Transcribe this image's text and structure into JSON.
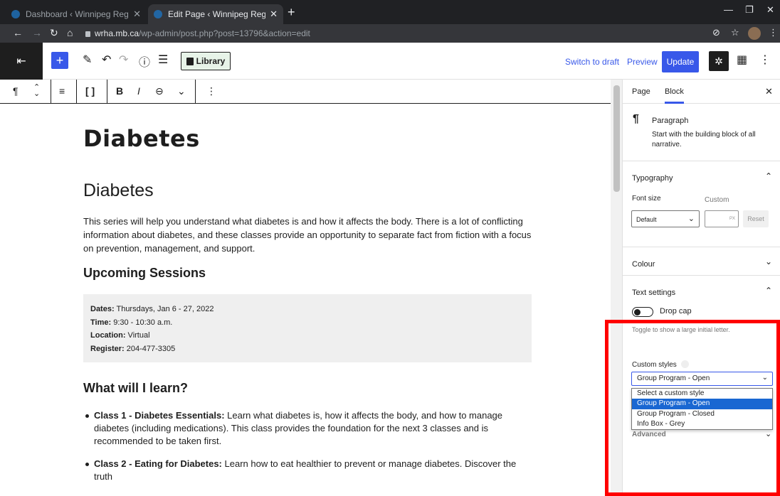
{
  "browser": {
    "tabs": [
      {
        "title": "Dashboard ‹ Winnipeg Regional He",
        "close": "✕"
      },
      {
        "title": "Edit Page ‹ Winnipeg Regional He",
        "close": "✕"
      }
    ],
    "new_tab": "+",
    "url_domain": "wrha.mb.ca",
    "url_path": "/wp-admin/post.php?post=13796&action=edit"
  },
  "editor_toolbar": {
    "library_label": "Library",
    "switch_to_draft": "Switch to draft",
    "preview": "Preview",
    "update": "Update"
  },
  "content": {
    "page_title": "Diabetes",
    "heading": "Diabetes",
    "intro": "This series will help you understand what diabetes is and how it affects the body. There is a lot of conflicting information about diabetes, and these classes provide an opportunity to separate fact from fiction with a focus on prevention, management, and support.",
    "upcoming_heading": "Upcoming Sessions",
    "info": [
      {
        "label": "Dates:",
        "value": " Thursdays, Jan 6 - 27, 2022"
      },
      {
        "label": "Time:",
        "value": " 9:30 - 10:30 a.m."
      },
      {
        "label": "Location:",
        "value": " Virtual"
      },
      {
        "label": "Register:",
        "value": " 204-477-3305"
      }
    ],
    "learn_heading": "What will I learn?",
    "classes": [
      {
        "label": "Class 1 - Diabetes Essentials:",
        "text": " Learn what diabetes is, how it affects the body, and how to manage diabetes (including medications). This class provides the foundation for the next 3 classes and is recommended to be taken first."
      },
      {
        "label": "Class 2 - Eating for Diabetes:",
        "text": " Learn how to eat healthier to prevent or manage diabetes. Discover the truth"
      }
    ]
  },
  "sidebar": {
    "tabs": [
      "Page",
      "Block"
    ],
    "active_tab": "Block",
    "block_name": "Paragraph",
    "block_desc": "Start with the building block of all narrative.",
    "typography": "Typography",
    "font_size_label": "Font size",
    "custom_label": "Custom",
    "font_size_value": "Default",
    "custom_unit": "PX",
    "reset": "Reset",
    "colour": "Colour",
    "text_settings": "Text settings",
    "drop_cap": "Drop cap",
    "drop_cap_help": "Toggle to show a large initial letter.",
    "custom_styles": "Custom styles",
    "custom_style_value": "Group Program - Open",
    "style_options": [
      "Select a custom style",
      "Group Program - Open",
      "Group Program - Closed",
      "Info Box - Grey"
    ],
    "advanced": "Advanced"
  },
  "colors": {
    "accent": "#3858e9",
    "highlight": "#ff0000"
  }
}
